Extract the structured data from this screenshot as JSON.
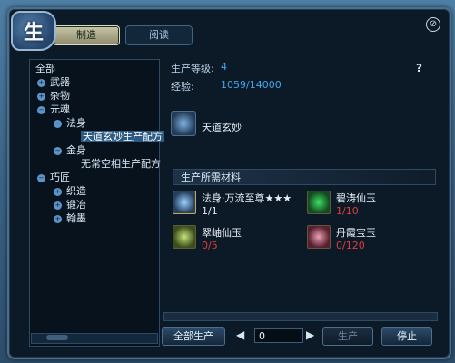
{
  "window": {
    "badge": "生",
    "close": "⊘"
  },
  "tabs": [
    {
      "label": "制造"
    },
    {
      "label": "阅读"
    }
  ],
  "tree": {
    "root": "全部",
    "weapons": "武器",
    "misc": "杂物",
    "soul": "元魂",
    "dharma": "法身",
    "dharma_recipe": "天道玄妙生产配方",
    "golden": "金身",
    "golden_recipe": "无常空相生产配方",
    "craft": "巧匠",
    "weave": "织造",
    "forge": "锻冶",
    "ink": "翰墨"
  },
  "info": {
    "level_label": "生产等级:",
    "level_value": "4",
    "exp_label": "经验:",
    "exp_value": "1059/14000",
    "help": "?"
  },
  "item": {
    "name": "天道玄妙"
  },
  "materials": {
    "header": "生产所需材料",
    "list": [
      {
        "name": "法身·万流至尊★★★",
        "count": "1/1",
        "color": "#e0e8ef"
      },
      {
        "name": "碧涛仙玉",
        "count": "1/10",
        "color": "#e03c3c"
      },
      {
        "name": "翠岫仙玉",
        "count": "0/5",
        "color": "#e03c3c"
      },
      {
        "name": "丹霞宝玉",
        "count": "0/120",
        "color": "#e03c3c"
      }
    ]
  },
  "controls": {
    "produce_all": "全部生产",
    "left": "◀",
    "qty": "0",
    "right": "▶",
    "produce": "生产",
    "stop": "停止"
  }
}
